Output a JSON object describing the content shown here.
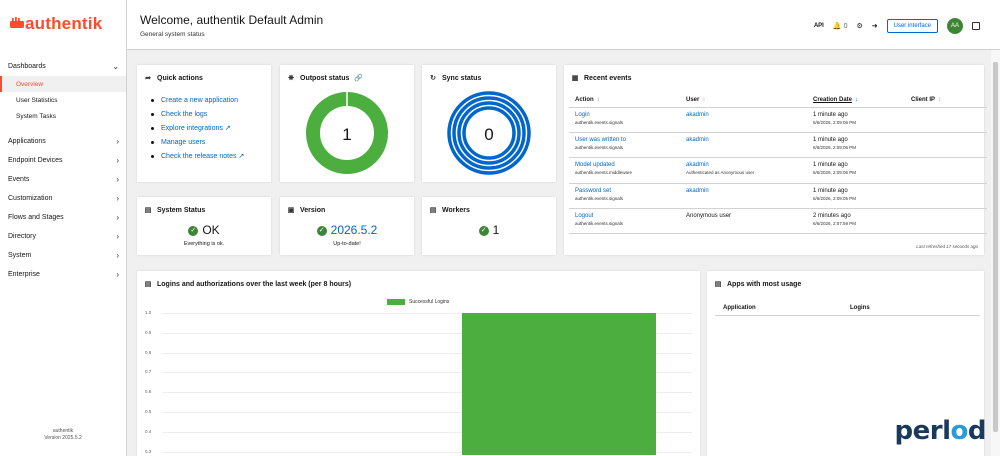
{
  "brand": {
    "name": "authentik",
    "color": "#fd4b2d"
  },
  "sidebar": {
    "groups": [
      {
        "label": "Dashboards",
        "chevron": "chevron-down",
        "children": [
          {
            "label": "Overview",
            "active": true
          },
          {
            "label": "User Statistics"
          },
          {
            "label": "System Tasks"
          }
        ]
      },
      {
        "label": "Applications",
        "chevron": "chevron-right"
      },
      {
        "label": "Endpoint Devices",
        "chevron": "chevron-right"
      },
      {
        "label": "Events",
        "chevron": "chevron-right"
      },
      {
        "label": "Customization",
        "chevron": "chevron-right"
      },
      {
        "label": "Flows and Stages",
        "chevron": "chevron-right"
      },
      {
        "label": "Directory",
        "chevron": "chevron-right"
      },
      {
        "label": "System",
        "chevron": "chevron-right"
      },
      {
        "label": "Enterprise",
        "chevron": "chevron-right"
      }
    ],
    "footer": {
      "name": "authentik",
      "version": "Version 2025.5.2"
    }
  },
  "header": {
    "title": "Welcome, authentik Default Admin",
    "subtitle": "General system status",
    "notifications_count": "0",
    "user_interface_label": "User interface",
    "avatar_initials": "AA"
  },
  "quick_actions": {
    "title": "Quick actions",
    "items": [
      {
        "label": "Create a new application",
        "external": false
      },
      {
        "label": "Check the logs",
        "external": false
      },
      {
        "label": "Explore integrations",
        "external": true
      },
      {
        "label": "Manage users",
        "external": false
      },
      {
        "label": "Check the release notes",
        "external": true
      }
    ]
  },
  "outpost_status": {
    "title": "Outpost status",
    "value": "1",
    "healthy_fraction": 1.0,
    "color": "#4cae3f"
  },
  "sync_status": {
    "title": "Sync status",
    "value": "0",
    "color": "#0066cc"
  },
  "system_status": {
    "title": "System Status",
    "value": "OK",
    "detail": "Everything is ok."
  },
  "version": {
    "title": "Version",
    "value": "2026.5.2",
    "detail": "Up-to-date!"
  },
  "workers": {
    "title": "Workers",
    "value": "1"
  },
  "recent_events": {
    "title": "Recent events",
    "columns": [
      "Action",
      "User",
      "Creation Date",
      "Client IP"
    ],
    "rows": [
      {
        "action": "Login",
        "app": "authentik.events.signals",
        "user": "akadmin",
        "user_sub": "",
        "date": "1 minute ago",
        "date_sub": "6/6/2026, 2:09:06 PM"
      },
      {
        "action": "User was written to",
        "app": "authentik.events.signals",
        "user": "akadmin",
        "user_sub": "",
        "date": "1 minute ago",
        "date_sub": "6/6/2026, 2:09:06 PM"
      },
      {
        "action": "Model updated",
        "app": "authentik.events.middleware",
        "user": "akadmin",
        "user_sub": "Authenticated as Anonymous user",
        "date": "1 minute ago",
        "date_sub": "6/6/2026, 2:09:06 PM"
      },
      {
        "action": "Password set",
        "app": "authentik.events.signals",
        "user": "akadmin",
        "user_sub": "",
        "date": "1 minute ago",
        "date_sub": "6/6/2026, 2:09:05 PM"
      },
      {
        "action": "Logout",
        "app": "authentik.events.signals",
        "user": "Anonymous user",
        "user_sub": "",
        "date": "2 minutes ago",
        "date_sub": "6/6/2026, 2:07:59 PM"
      }
    ],
    "refreshed": "Last refreshed 17 seconds ago"
  },
  "logins_chart": {
    "title": "Logins and authorizations over the last week (per 8 hours)"
  },
  "chart_data": {
    "type": "bar",
    "title": "",
    "series": [
      {
        "name": "Successful Logins",
        "values": [
          1.0
        ],
        "color": "#4cae3f"
      }
    ],
    "y_ticks": [
      "1.0",
      "0.9",
      "0.8",
      "0.7",
      "0.6",
      "0.5",
      "0.4",
      "0.3"
    ],
    "ylim": [
      0,
      1.0
    ],
    "grid": true,
    "legend": "top-center"
  },
  "apps_most_usage": {
    "title": "Apps with most usage",
    "columns": [
      "Application",
      "Logins"
    ]
  },
  "watermark": {
    "text_a": "perl",
    "text_b": "o",
    "text_c": "d"
  }
}
